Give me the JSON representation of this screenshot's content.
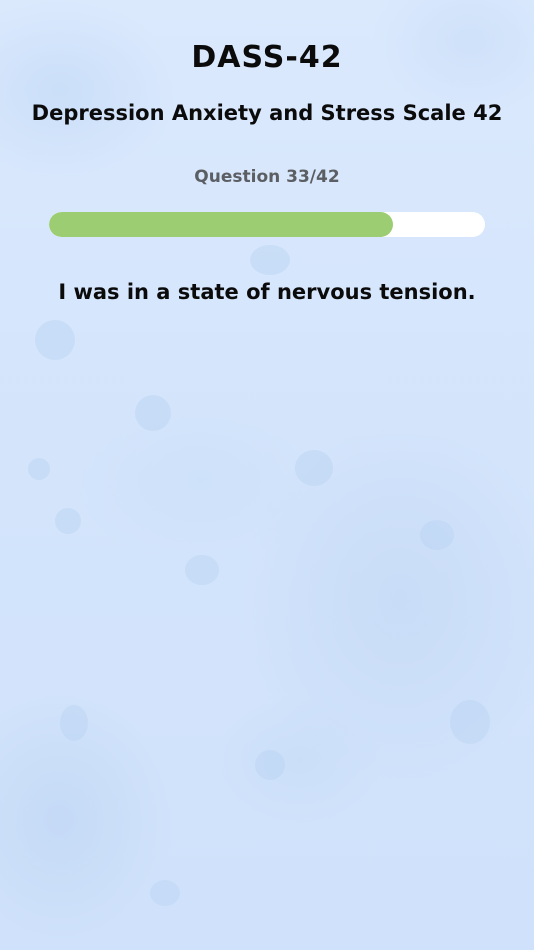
{
  "header": {
    "title": "DASS-42",
    "subtitle": "Depression Anxiety and Stress Scale 42"
  },
  "progress": {
    "label": "Question 33/42",
    "current": 33,
    "total": 42,
    "fraction": 0.79,
    "fill_color": "#9ccd72",
    "track_color": "#ffffff"
  },
  "question": {
    "text": "I was in a state of nervous tension."
  },
  "theme": {
    "background_color": "#d6e6fc",
    "text_color": "#0b0b0b",
    "muted_text_color": "#5b5e63"
  }
}
